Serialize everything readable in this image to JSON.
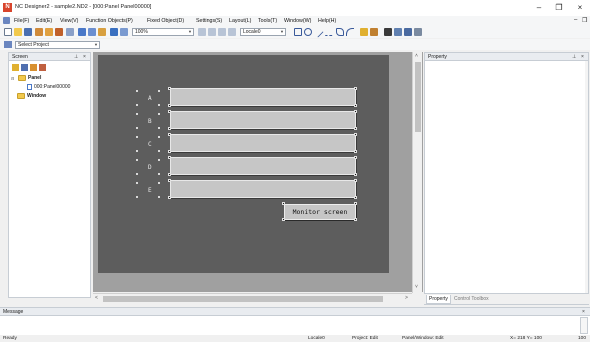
{
  "window": {
    "title": "NC Designer2 - sample2.ND2 - [000:Panel Panel00000]",
    "app_icon_glyph": "N",
    "minimize_glyph": "–",
    "restore_glyph": "❐",
    "close_glyph": "×",
    "mdi_minimize_glyph": "–",
    "mdi_restore_glyph": "❐"
  },
  "menu": {
    "items": [
      "File(F)",
      "Edit(E)",
      "View(V)",
      "Function Objects(P)",
      "Fixed Object(D)",
      "Settings(S)",
      "Layout(L)",
      "Tools(T)",
      "Window(W)",
      "Help(H)"
    ]
  },
  "toolbar": {
    "zoom_value": "100%",
    "locale_value": "Locale0",
    "project_select_value": "Select Project"
  },
  "screen_panel": {
    "title": "Screen",
    "pin_glyph": "⊥",
    "close_glyph": "×",
    "tree": [
      {
        "label": "Panel",
        "bold": true,
        "expander": "⊟"
      },
      {
        "label": "000:Panel00000",
        "bold": false,
        "expander": ""
      },
      {
        "label": "Window",
        "bold": true,
        "expander": ""
      }
    ]
  },
  "design": {
    "field_labels": [
      "A",
      "B",
      "C",
      "D",
      "E"
    ],
    "monitor_button_label": "Monitor screen"
  },
  "property_panel": {
    "title": "Property",
    "pin_glyph": "⊥",
    "close_glyph": "×",
    "tabs": [
      "Property",
      "Control Toolbox"
    ],
    "active_tab": "Property"
  },
  "message_panel": {
    "title": "Message",
    "close_glyph": "×"
  },
  "status": {
    "ready": "Ready",
    "locale": "Locale0",
    "project_mode": "Project: Edit",
    "panel_mode": "Panel/Window: Edit",
    "coords": "X= 218 Y= 100",
    "zoom": "100"
  },
  "colors": {
    "design_bg": "#5d5d5d",
    "canvas_bg": "#a0a0a0",
    "field_bg": "#c6c6c6",
    "app_icon": "#d8442c"
  }
}
